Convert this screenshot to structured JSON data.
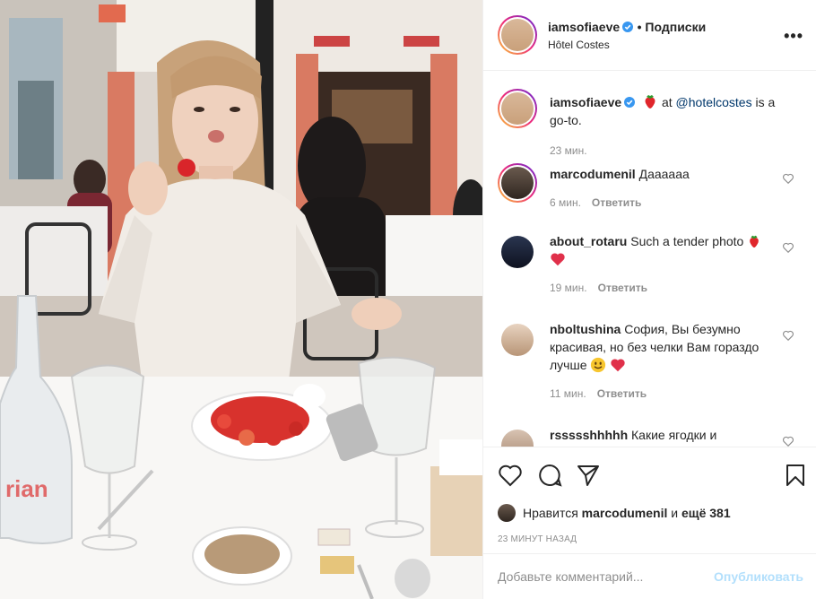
{
  "header": {
    "username": "iamsofiaeve",
    "follow_label": "• Подписки",
    "location": "Hôtel Costes",
    "more_label": "•••"
  },
  "caption": {
    "username": "iamsofiaeve",
    "text_before": "at",
    "mention": "@hotelcostes",
    "text_after": "is a go-to.",
    "time": "23 мин."
  },
  "comments": [
    {
      "username": "marcodumenil",
      "text": "Даааааа",
      "time": "6 мин.",
      "reply": "Ответить"
    },
    {
      "username": "about_rotaru",
      "text": "Such a tender photo",
      "time": "19 мин.",
      "reply": "Ответить"
    },
    {
      "username": "nboltushina",
      "text": "София, Вы безумно красивая, но без челки Вам гораздо лучше",
      "time": "11 мин.",
      "reply": "Ответить"
    },
    {
      "username": "rssssshhhhh",
      "text": "Какие ягодки и",
      "time": "",
      "reply": ""
    }
  ],
  "likes": {
    "prefix": "Нравится",
    "user": "marcodumenil",
    "middle": "и",
    "rest": "ещё 381"
  },
  "posted_ago": "23 минут назад",
  "add_comment": {
    "placeholder": "Добавьте комментарий...",
    "publish": "Опубликовать"
  },
  "photo": {
    "bottle_label": "rian"
  },
  "colors": {
    "link": "#00376b",
    "muted": "#8e8e8e",
    "publish_disabled": "#b2dffc",
    "verified": "#3897f0"
  }
}
